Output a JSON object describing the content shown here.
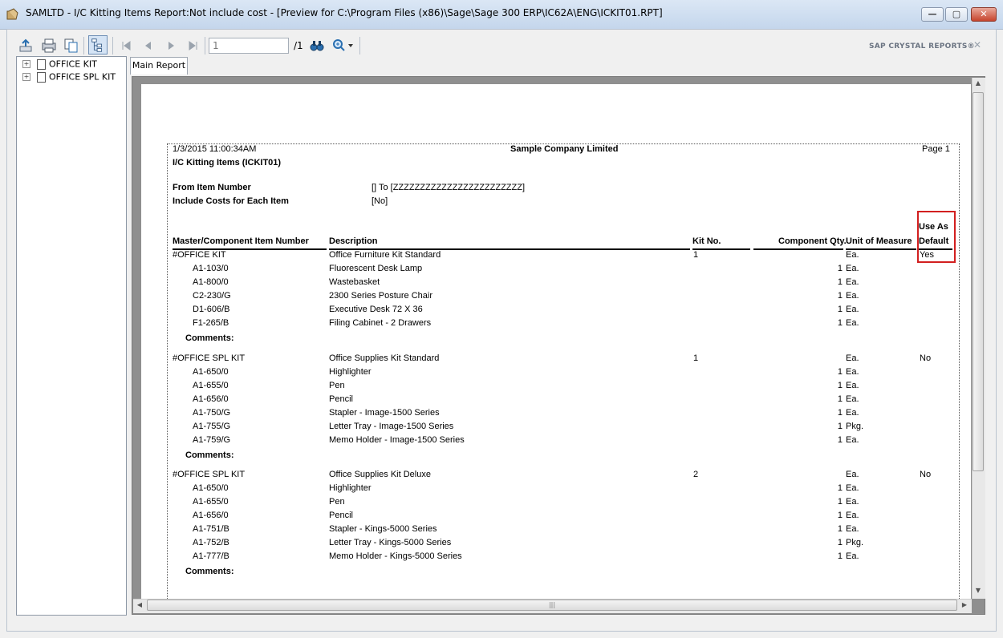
{
  "window": {
    "title": "SAMLTD - I/C Kitting Items Report:Not include cost - [Preview for C:\\Program Files (x86)\\Sage\\Sage 300 ERP\\IC62A\\ENG\\ICKIT01.RPT]",
    "minimize": "—",
    "maximize": "▢",
    "close": "✕"
  },
  "toolbar": {
    "page_value": "1",
    "page_total": "/1",
    "brand": "SAP CRYSTAL REPORTS®",
    "close_glyph": "✕"
  },
  "tree": {
    "items": [
      {
        "label": "OFFICE KIT"
      },
      {
        "label": "OFFICE SPL KIT"
      }
    ]
  },
  "tabs": {
    "main": "Main Report"
  },
  "report": {
    "datetime": "1/3/2015  11:00:34AM",
    "company": "Sample Company Limited",
    "page": "Page 1",
    "report_title": "I/C Kitting Items  (ICKIT01)",
    "filter_from_label": "From Item Number",
    "filter_from_value": "[] To [ZZZZZZZZZZZZZZZZZZZZZZZZ]",
    "filter_cost_label": "Include Costs for Each Item",
    "filter_cost_value": "[No]",
    "columns": {
      "item": "Master/Component  Item Number",
      "desc": "Description",
      "kit": "Kit No.",
      "qty": "Component Qty.",
      "uom": "Unit of Measure",
      "default_1": "Use As",
      "default_2": "Default"
    },
    "comments_label": "Comments:",
    "kits": [
      {
        "item": "#OFFICE KIT",
        "desc": "Office Furniture Kit Standard",
        "kit": "1",
        "uom": "Ea.",
        "default": "Yes",
        "components": [
          {
            "item": "A1-103/0",
            "desc": "Fluorescent Desk Lamp",
            "qty": "1",
            "uom": "Ea."
          },
          {
            "item": "A1-800/0",
            "desc": "Wastebasket",
            "qty": "1",
            "uom": "Ea."
          },
          {
            "item": "C2-230/G",
            "desc": "2300 Series Posture Chair",
            "qty": "1",
            "uom": "Ea."
          },
          {
            "item": "D1-606/B",
            "desc": "Executive Desk 72 X 36",
            "qty": "1",
            "uom": "Ea."
          },
          {
            "item": "F1-265/B",
            "desc": "Filing Cabinet - 2 Drawers",
            "qty": "1",
            "uom": "Ea."
          }
        ]
      },
      {
        "item": "#OFFICE SPL KIT",
        "desc": "Office Supplies Kit Standard",
        "kit": "1",
        "uom": "Ea.",
        "default": "No",
        "components": [
          {
            "item": "A1-650/0",
            "desc": "Highlighter",
            "qty": "1",
            "uom": "Ea."
          },
          {
            "item": "A1-655/0",
            "desc": "Pen",
            "qty": "1",
            "uom": "Ea."
          },
          {
            "item": "A1-656/0",
            "desc": "Pencil",
            "qty": "1",
            "uom": "Ea."
          },
          {
            "item": "A1-750/G",
            "desc": "Stapler - Image-1500 Series",
            "qty": "1",
            "uom": "Ea."
          },
          {
            "item": "A1-755/G",
            "desc": "Letter Tray - Image-1500 Series",
            "qty": "1",
            "uom": "Pkg."
          },
          {
            "item": "A1-759/G",
            "desc": "Memo Holder - Image-1500 Series",
            "qty": "1",
            "uom": "Ea."
          }
        ]
      },
      {
        "item": "#OFFICE SPL KIT",
        "desc": "Office Supplies Kit Deluxe",
        "kit": "2",
        "uom": "Ea.",
        "default": "No",
        "components": [
          {
            "item": "A1-650/0",
            "desc": "Highlighter",
            "qty": "1",
            "uom": "Ea."
          },
          {
            "item": "A1-655/0",
            "desc": "Pen",
            "qty": "1",
            "uom": "Ea."
          },
          {
            "item": "A1-656/0",
            "desc": "Pencil",
            "qty": "1",
            "uom": "Ea."
          },
          {
            "item": "A1-751/B",
            "desc": "Stapler - Kings-5000 Series",
            "qty": "1",
            "uom": "Ea."
          },
          {
            "item": "A1-752/B",
            "desc": "Letter Tray - Kings-5000 Series",
            "qty": "1",
            "uom": "Pkg."
          },
          {
            "item": "A1-777/B",
            "desc": "Memo Holder - Kings-5000 Series",
            "qty": "1",
            "uom": "Ea."
          }
        ]
      }
    ]
  },
  "colors": {
    "highlight": "#d21f1f",
    "titlebar": "#c4d6ec"
  }
}
